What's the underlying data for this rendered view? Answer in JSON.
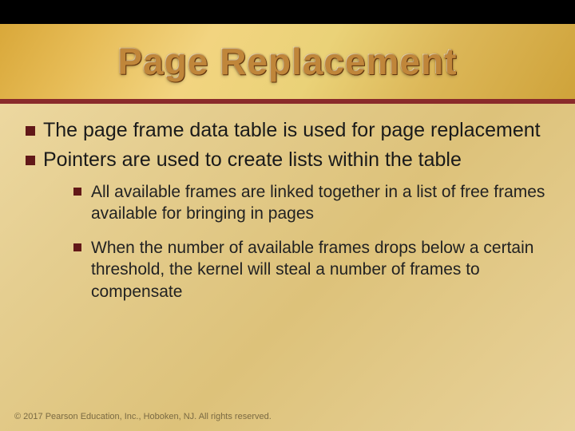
{
  "header": {
    "title": "Page Replacement"
  },
  "bullets": {
    "main": [
      "The page frame data table is used for page replacement",
      "Pointers are used to create lists within the table"
    ],
    "sub": [
      "All available frames are linked together in a list of free frames available for bringing in pages",
      "When the number of available frames drops below a certain threshold, the kernel will steal a number of frames to compensate"
    ]
  },
  "footer": {
    "copyright": "© 2017 Pearson Education, Inc., Hoboken, NJ. All rights reserved."
  }
}
